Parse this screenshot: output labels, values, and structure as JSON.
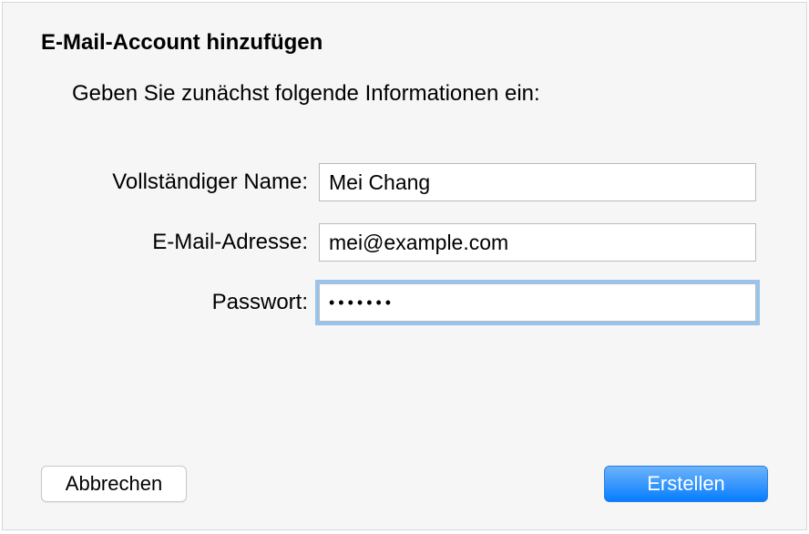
{
  "title": "E-Mail-Account hinzufügen",
  "instruction": "Geben Sie zunächst folgende Informationen ein:",
  "fields": {
    "fullname": {
      "label": "Vollständiger Name:",
      "value": "Mei Chang"
    },
    "email": {
      "label": "E-Mail-Adresse:",
      "value": "mei@example.com"
    },
    "password": {
      "label": "Passwort:",
      "value": "•••••••"
    }
  },
  "buttons": {
    "cancel": "Abbrechen",
    "create": "Erstellen"
  }
}
